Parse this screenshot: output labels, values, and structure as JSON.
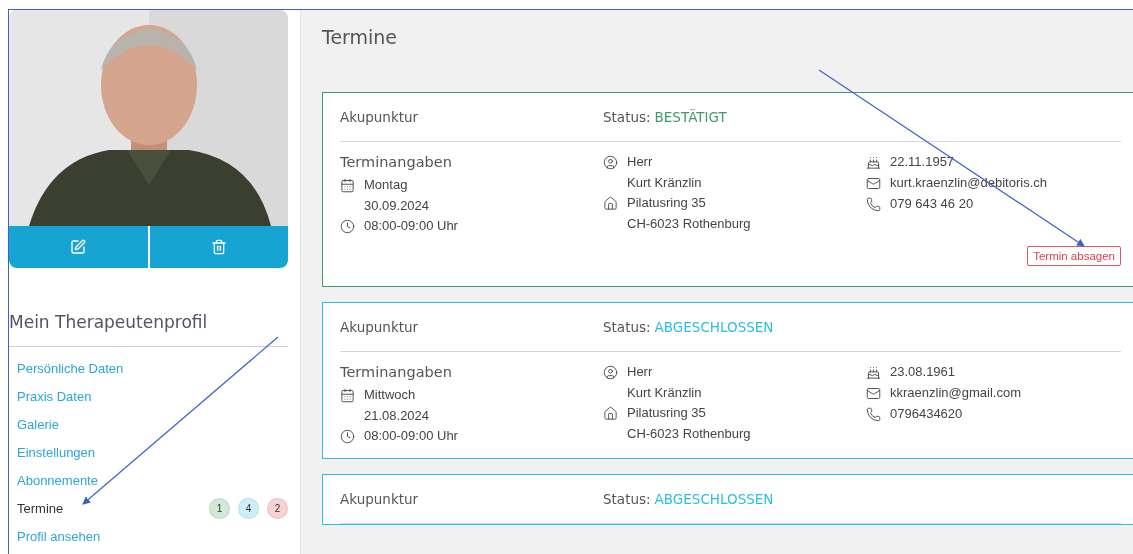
{
  "sidebar": {
    "heading": "Mein Therapeutenprofil",
    "items": [
      {
        "label": "Persönliche Daten",
        "selected": false
      },
      {
        "label": "Praxis Daten",
        "selected": false
      },
      {
        "label": "Galerie",
        "selected": false
      },
      {
        "label": "Einstellungen",
        "selected": false
      },
      {
        "label": "Abonnemente",
        "selected": false
      },
      {
        "label": "Termine",
        "selected": true,
        "badges": [
          {
            "count": "1",
            "color": "#d4e8d9"
          },
          {
            "count": "4",
            "color": "#cdeffa"
          },
          {
            "count": "2",
            "color": "#f8d3d6"
          }
        ]
      },
      {
        "label": "Profil ansehen",
        "selected": false
      }
    ]
  },
  "title": "Termine",
  "appointments": [
    {
      "service": "Akupunktur",
      "status_label": "Status:",
      "status": "BESTÄTIGT",
      "color": "#3f9b6b",
      "section": "Terminangaben",
      "weekday": "Montag",
      "date": "30.09.2024",
      "time": "08:00-09:00 Uhr",
      "salutation": "Herr",
      "name": "Kurt Kränzlin",
      "street": "Pilatusring 35",
      "city": "CH-6023 Rothenburg",
      "birthdate": "22.11.1957",
      "email": "kurt.kraenzlin@debitoris.ch",
      "phone": "079 643 46 20",
      "action": "Termin absagen"
    },
    {
      "service": "Akupunktur",
      "status_label": "Status:",
      "status": "ABGESCHLOSSEN",
      "color": "#2bbde3",
      "section": "Terminangaben",
      "weekday": "Mittwoch",
      "date": "21.08.2024",
      "time": "08:00-09:00 Uhr",
      "salutation": "Herr",
      "name": "Kurt Kränzlin",
      "street": "Pilatusring 35",
      "city": "CH-6023 Rothenburg",
      "birthdate": "23.08.1961",
      "email": "kkraenzlin@gmail.com",
      "phone": "0796434620"
    },
    {
      "service": "Akupunktur",
      "status_label": "Status:",
      "status": "ABGESCHLOSSEN",
      "color": "#2bbde3"
    }
  ]
}
